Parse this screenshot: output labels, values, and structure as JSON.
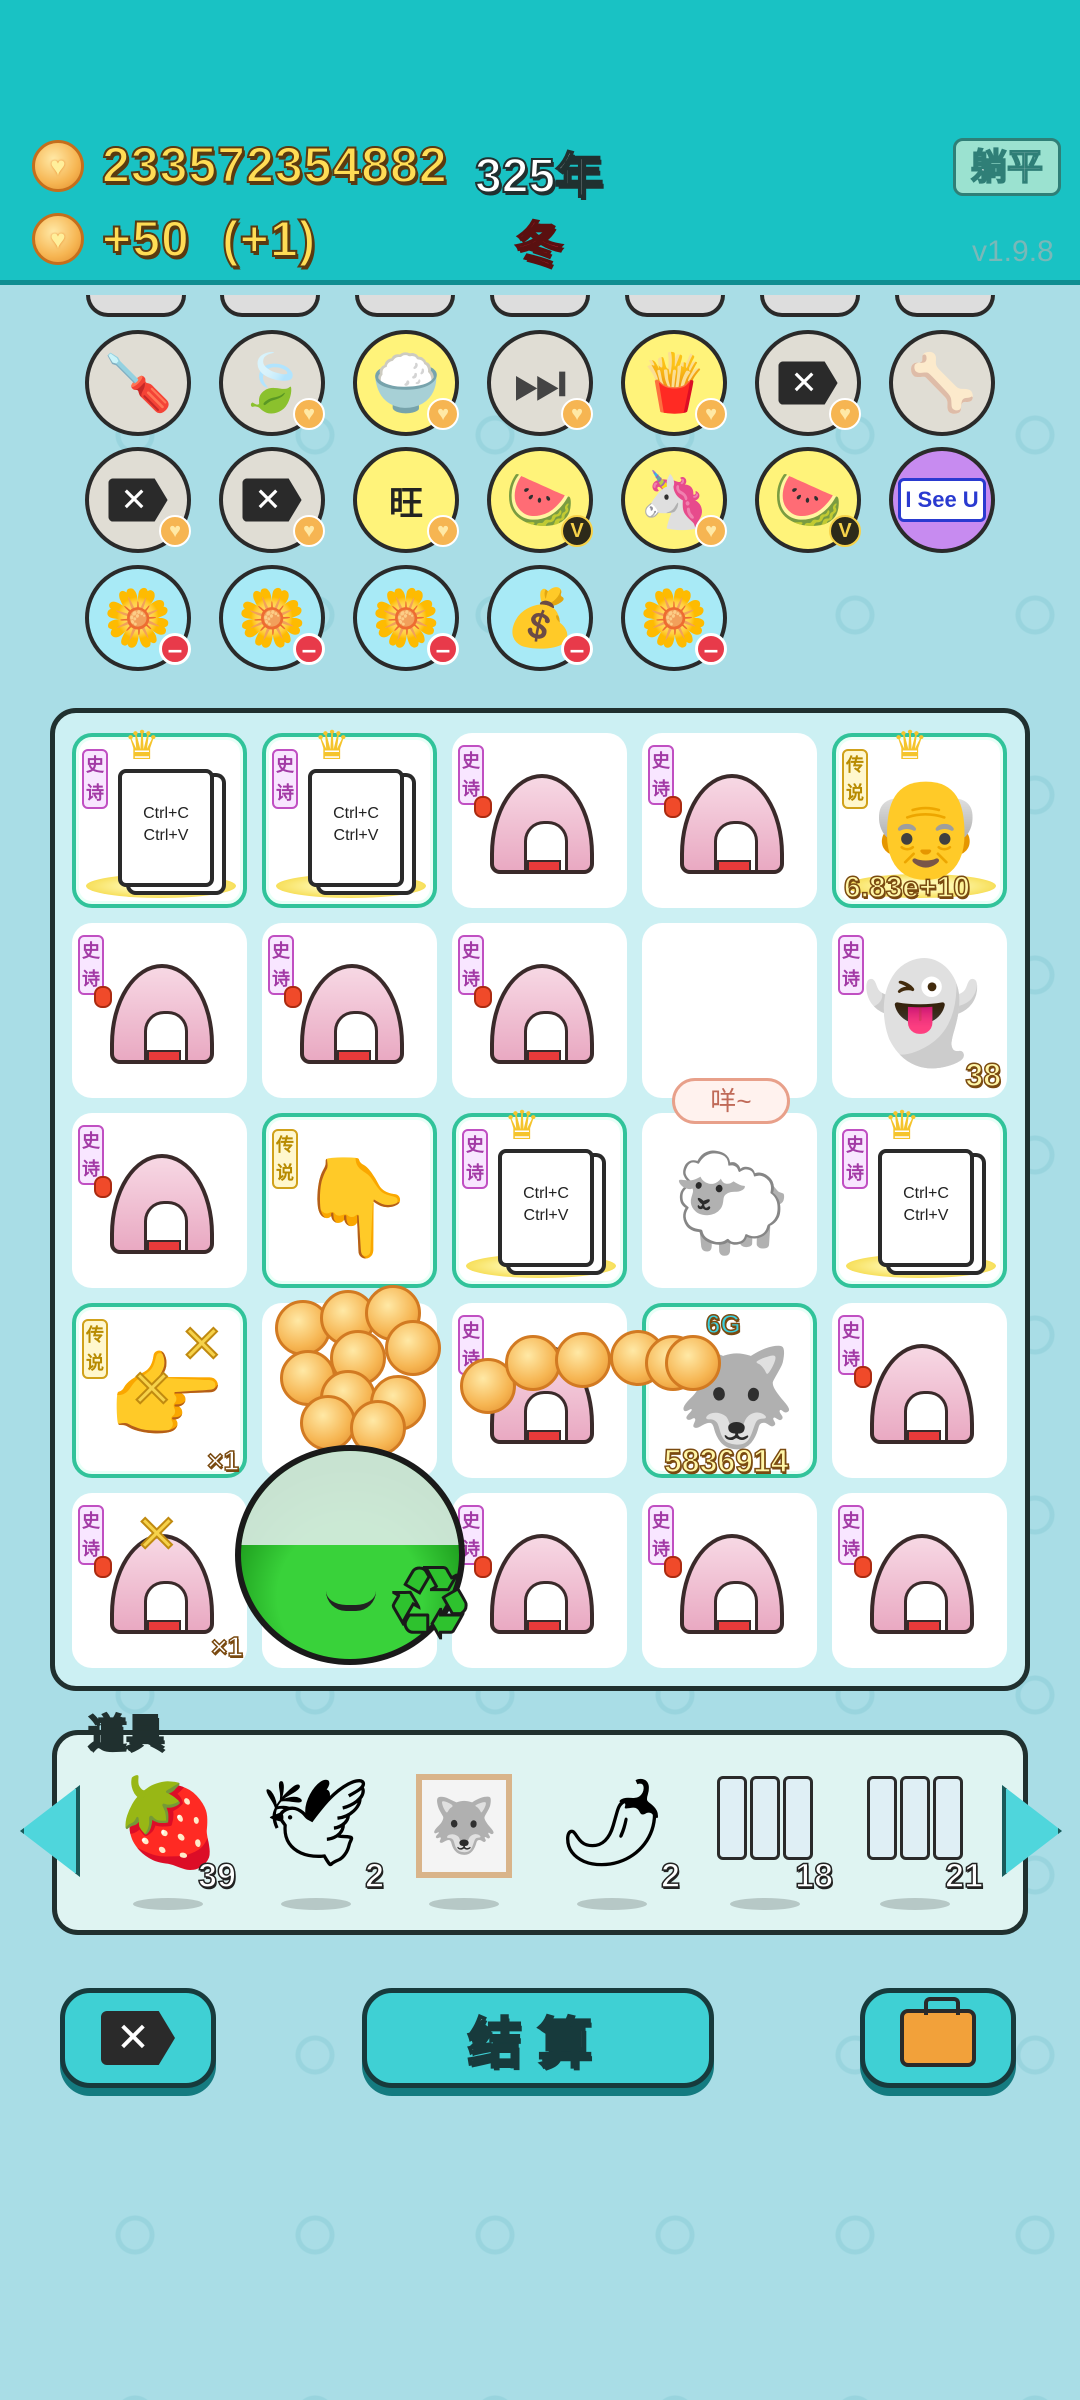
{
  "header": {
    "coins_total": "233572354882",
    "year": "325年",
    "income": "+50",
    "income_bonus": "(+1)",
    "season": "冬",
    "lie_flat_button": "躺平",
    "version": "v1.9.8"
  },
  "top_icons": [
    {
      "name": "screwdriver",
      "glyph": "🪛",
      "badge": ""
    },
    {
      "name": "leaf",
      "glyph": "🍃",
      "badge": "heart"
    },
    {
      "name": "rice-bowl",
      "glyph": "🍚",
      "badge": "heart"
    },
    {
      "name": "skip",
      "glyph": "⏭",
      "badge": "heart"
    },
    {
      "name": "fries",
      "glyph": "🍟",
      "badge": "heart"
    },
    {
      "name": "kill-tag",
      "glyph": "⌫",
      "badge": "heart"
    },
    {
      "name": "pet-bowl",
      "glyph": "🦴",
      "badge": ""
    },
    {
      "name": "kill-tag-2",
      "glyph": "⌫",
      "badge": "heart"
    },
    {
      "name": "kill-tag-3",
      "glyph": "⌫",
      "badge": "heart"
    },
    {
      "name": "wang-chars",
      "glyph": "旺",
      "badge": "heart"
    },
    {
      "name": "fruit-plate",
      "glyph": "🍉",
      "badge": "v"
    },
    {
      "name": "unicorn",
      "glyph": "🦄",
      "badge": "heart"
    },
    {
      "name": "fruit-plate-2",
      "glyph": "🍉",
      "badge": "v"
    },
    {
      "name": "i-see-u",
      "glyph": "I See U",
      "badge": ""
    },
    {
      "name": "flower-pot",
      "glyph": "🌼",
      "badge": "minus"
    },
    {
      "name": "flower-pot-2",
      "glyph": "🌼",
      "badge": "minus"
    },
    {
      "name": "flower-pot-3",
      "glyph": "🌼",
      "badge": "minus"
    },
    {
      "name": "money-bag",
      "glyph": "💰",
      "badge": "minus"
    },
    {
      "name": "flower-pot-4",
      "glyph": "🌼",
      "badge": "minus"
    }
  ],
  "board": {
    "tag_epic": "史诗",
    "tag_legend": "传说",
    "copy_paste_text": "Ctrl+C Ctrl+V",
    "old_man_value": "6.83e+10",
    "ghost_count": "38",
    "sheep_speech": "咩~",
    "husky_level": "6G",
    "husky_value": "5836914",
    "multiplier_1": "×1",
    "multiplier_2": "×1"
  },
  "items": {
    "title": "道具",
    "list": [
      {
        "name": "strawberry",
        "glyph": "🍓",
        "qty": "39"
      },
      {
        "name": "dove",
        "glyph": "🕊",
        "qty": "2"
      },
      {
        "name": "framed-photo",
        "glyph": "🐺",
        "qty": ""
      },
      {
        "name": "chili",
        "glyph": "🌶",
        "qty": "2"
      },
      {
        "name": "epic-jars",
        "glyph": "",
        "qty": "18"
      },
      {
        "name": "empty-jars",
        "glyph": "",
        "qty": "21"
      }
    ]
  },
  "buttons": {
    "settle": "结算",
    "kill_symbol": "✕"
  },
  "colors": {
    "header": "#19c2c4",
    "background": "#a9dde6",
    "board": "#ccf0f3",
    "accent_button": "#3fd0d4",
    "glow_border": "#31c39a"
  }
}
